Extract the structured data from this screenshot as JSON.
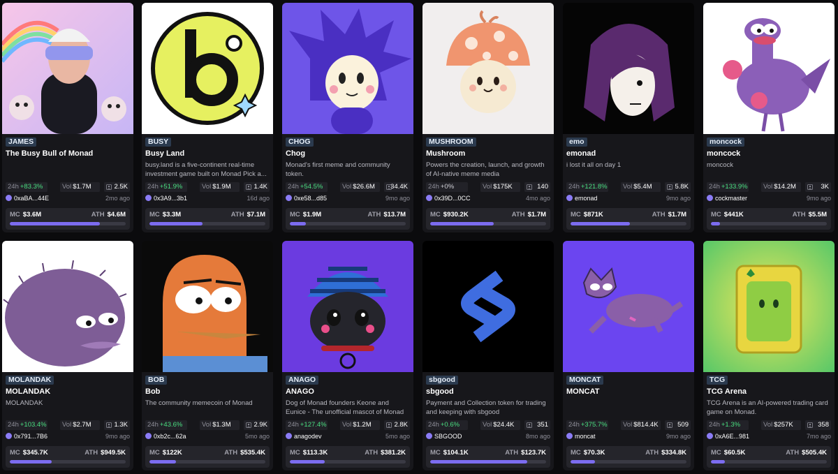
{
  "labels": {
    "h24": "24h",
    "vol": "Vol",
    "mc": "MC",
    "ath": "ATH"
  },
  "colors": {
    "accent": "#7c6cf0",
    "positive": "#4ade80",
    "card": "#17171b",
    "ticker_bg": "#2b3a4e"
  },
  "cards": [
    {
      "ticker": "JAMES",
      "name": "The Busy Bull of Monad",
      "desc": "",
      "change24h": "+83.3%",
      "volume": "$1.7M",
      "holders": "2.5K",
      "creator": "0xaBA...44E",
      "age": "2mo ago",
      "mc": "$3.6M",
      "ath": "$4.6M",
      "progress": 0.78,
      "image": "rainbow-selfie"
    },
    {
      "ticker": "BUSY",
      "name": "Busy Land",
      "desc": "busy.land is a five-continent real-time investment game built on Monad Pick a...",
      "change24h": "+51.9%",
      "volume": "$1.9M",
      "holders": "1.4K",
      "creator": "0x3A9...3b1",
      "age": "16d ago",
      "mc": "$3.3M",
      "ath": "$7.1M",
      "progress": 0.46,
      "image": "b-logo"
    },
    {
      "ticker": "CHOG",
      "name": "Chog",
      "desc": "Monad's first meme and community token.",
      "change24h": "+54.5%",
      "volume": "$26.6M",
      "holders": "34.4K",
      "creator": "0xe58...d85",
      "age": "9mo ago",
      "mc": "$1.9M",
      "ath": "$13.7M",
      "progress": 0.14,
      "image": "purple-hedgehog"
    },
    {
      "ticker": "MUSHROOM",
      "name": "Mushroom",
      "desc": "Powers the creation, launch, and growth of AI-native meme media",
      "change24h": "+0%",
      "volume": "$175K",
      "holders": "140",
      "creator": "0x39D...0CC",
      "age": "4mo ago",
      "mc": "$930.2K",
      "ath": "$1.7M",
      "progress": 0.55,
      "image": "mushroom-character"
    },
    {
      "ticker": "emo",
      "name": "emonad",
      "desc": "i lost it all on day 1",
      "change24h": "+121.8%",
      "volume": "$5.4M",
      "holders": "5.8K",
      "creator": "emonad",
      "age": "9mo ago",
      "mc": "$871K",
      "ath": "$1.7M",
      "progress": 0.51,
      "image": "emo-hair-face"
    },
    {
      "ticker": "moncock",
      "name": "moncock",
      "desc": "moncock",
      "change24h": "+133.9%",
      "volume": "$14.2M",
      "holders": "3K",
      "creator": "cockmaster",
      "age": "9mo ago",
      "mc": "$441K",
      "ath": "$5.5M",
      "progress": 0.08,
      "image": "boxing-chicken"
    },
    {
      "ticker": "MOLANDAK",
      "name": "MOLANDAK",
      "desc": "MOLANDAK",
      "change24h": "+103.4%",
      "volume": "$2.7M",
      "holders": "1.3K",
      "creator": "0x791...7B6",
      "age": "9mo ago",
      "mc": "$345.7K",
      "ath": "$949.5K",
      "progress": 0.36,
      "image": "purple-hedgehog-pepe"
    },
    {
      "ticker": "BOB",
      "name": "Bob",
      "desc": "The community memecoin of Monad",
      "change24h": "+43.6%",
      "volume": "$1.3M",
      "holders": "2.9K",
      "creator": "0xb2c...62a",
      "age": "5mo ago",
      "mc": "$122K",
      "ath": "$535.4K",
      "progress": 0.23,
      "image": "orange-bob"
    },
    {
      "ticker": "ANAGO",
      "name": "ANAGO",
      "desc": "Dog of Monad founders Keone and Eunice - The unofficial mascot of Monad",
      "change24h": "+127.4%",
      "volume": "$1.2M",
      "holders": "2.8K",
      "creator": "anagodev",
      "age": "5mo ago",
      "mc": "$113.3K",
      "ath": "$381.2K",
      "progress": 0.3,
      "image": "pug-beanie"
    },
    {
      "ticker": "sbgood",
      "name": "sbgood",
      "desc": "Payment and Collection token for trading and keeping with sbgood",
      "change24h": "+0.6%",
      "volume": "$24.4K",
      "holders": "351",
      "creator": "SBGOOD",
      "age": "8mo ago",
      "mc": "$104.1K",
      "ath": "$123.7K",
      "progress": 0.84,
      "image": "s-logo"
    },
    {
      "ticker": "MONCAT",
      "name": "MONCAT",
      "desc": "",
      "change24h": "+375.7%",
      "volume": "$814.4K",
      "holders": "509",
      "creator": "moncat",
      "age": "9mo ago",
      "mc": "$70.3K",
      "ath": "$334.8K",
      "progress": 0.21,
      "image": "purple-cat-sketch"
    },
    {
      "ticker": "TCG",
      "name": "TCG Arena",
      "desc": "TCG Arena is an AI-powered trading card game on Monad.",
      "change24h": "+1.3%",
      "volume": "$257K",
      "holders": "358",
      "creator": "0xA6E...981",
      "age": "7mo ago",
      "mc": "$60.5K",
      "ath": "$505.4K",
      "progress": 0.12,
      "image": "green-card"
    }
  ]
}
